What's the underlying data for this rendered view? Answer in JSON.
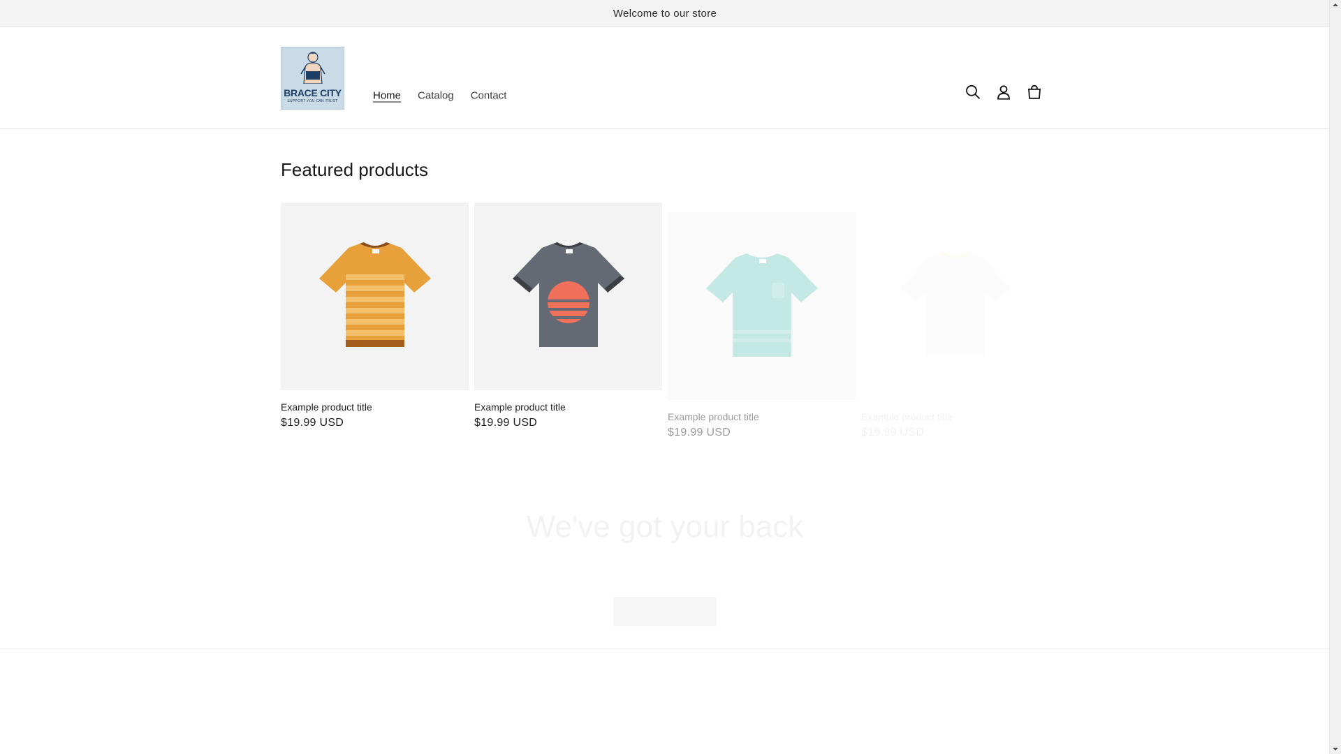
{
  "announcement": {
    "text": "Welcome to our store"
  },
  "header": {
    "logo": {
      "title": "BRACE CITY",
      "tagline": "SUPPORT YOU CAN TRUST"
    },
    "nav": [
      {
        "label": "Home",
        "active": true
      },
      {
        "label": "Catalog",
        "active": false
      },
      {
        "label": "Contact",
        "active": false
      }
    ],
    "icons": [
      "search-icon",
      "account-icon",
      "cart-icon"
    ]
  },
  "featured": {
    "title": "Featured products",
    "products": [
      {
        "title": "Example product title",
        "price": "$19.99 USD",
        "color": "#e39d2e",
        "trim": "#a35d1d",
        "style": "striped-orange"
      },
      {
        "title": "Example product title",
        "price": "$19.99 USD",
        "color": "#646a73",
        "trim": "#3c3f44",
        "style": "grey-sunset"
      },
      {
        "title": "Example product title",
        "price": "$19.99 USD",
        "color": "#7ecdc4",
        "trim": "#6ab8b0",
        "style": "mint-pocket"
      },
      {
        "title": "Example product title",
        "price": "$19.99 USD",
        "color": "#e0e0e0",
        "trim": "#f0c02b",
        "style": "faded"
      }
    ]
  },
  "banner": {
    "title": "We've got your back"
  }
}
